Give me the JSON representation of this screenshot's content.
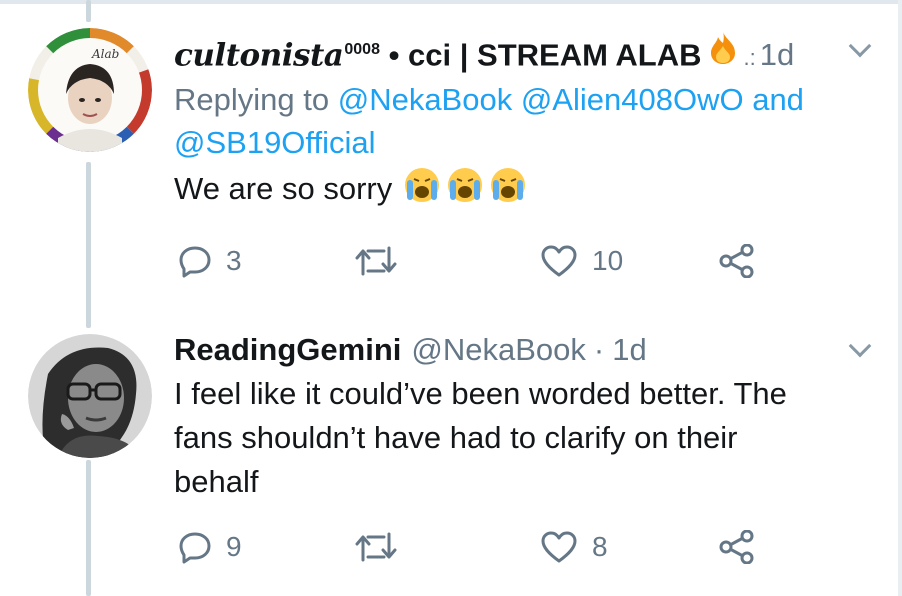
{
  "tweets": [
    {
      "display_name_script": "cultonista",
      "display_name_sup": "0008",
      "display_name_rest": " • cci | STREAM ALAB ",
      "extra_glyph": ".:",
      "time": "1d",
      "replying_label": "Replying to",
      "mentions_line1": "@NekaBook @Alien408OwO",
      "and_label": "and",
      "mentions_line2": "@SB19Official",
      "text": "We are so sorry",
      "reply_count": "3",
      "retweet_count": "",
      "like_count": "10"
    },
    {
      "display_name": "ReadingGemini",
      "handle": "@NekaBook",
      "separator": "·",
      "time": "1d",
      "text_line1": "I feel like it could’ve been worded better. The",
      "text_line2": "fans shouldn’t have had to clarify on their",
      "text_line3": "behalf",
      "reply_count": "9",
      "retweet_count": "",
      "like_count": "8"
    }
  ],
  "icons": [
    "reply-icon",
    "retweet-icon",
    "like-icon",
    "share-icon",
    "fire-icon",
    "crying-face-icon",
    "chevron-down-icon"
  ],
  "colors": {
    "text": "#14171a",
    "muted": "#657786",
    "link": "#1da1f2",
    "thread_line": "#ccd6dd"
  }
}
